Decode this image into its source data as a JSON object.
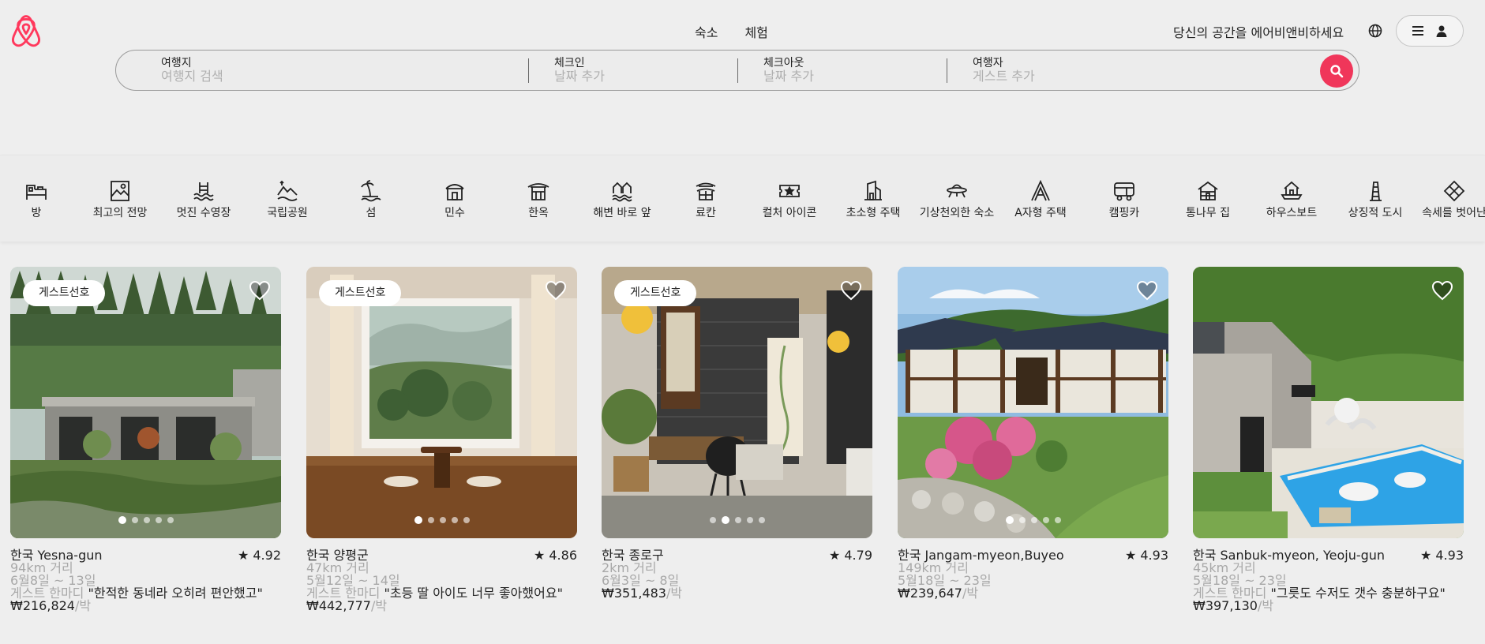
{
  "colors": {
    "brand": "#ff385c",
    "search_button": "#f0365a"
  },
  "header": {
    "tabs": [
      "숙소",
      "체험"
    ],
    "host_link": "당신의 공간을 에어비앤비하세요",
    "icons": [
      "airbnb-logo-icon",
      "globe-icon",
      "menu-icon",
      "user-icon"
    ]
  },
  "search": {
    "fields": [
      {
        "label": "여행지",
        "placeholder": "여행지 검색"
      },
      {
        "label": "체크인",
        "placeholder": "날짜 추가"
      },
      {
        "label": "체크아웃",
        "placeholder": "날짜 추가"
      },
      {
        "label": "여행자",
        "placeholder": "게스트 추가"
      }
    ],
    "button_icon": "search-icon"
  },
  "categories": [
    {
      "label": "방",
      "icon": "room-icon"
    },
    {
      "label": "최고의 전망",
      "icon": "view-icon"
    },
    {
      "label": "멋진 수영장",
      "icon": "pool-icon"
    },
    {
      "label": "국립공원",
      "icon": "national-park-icon"
    },
    {
      "label": "섬",
      "icon": "island-icon"
    },
    {
      "label": "민수",
      "icon": "minsu-icon"
    },
    {
      "label": "한옥",
      "icon": "hanok-icon"
    },
    {
      "label": "해변 바로 앞",
      "icon": "beachfront-icon"
    },
    {
      "label": "료칸",
      "icon": "ryokan-icon"
    },
    {
      "label": "컬처 아이콘",
      "icon": "ticket-icon"
    },
    {
      "label": "초소형 주택",
      "icon": "tiny-home-icon"
    },
    {
      "label": "기상천외한 숙소",
      "icon": "ufo-icon"
    },
    {
      "label": "A자형 주택",
      "icon": "a-frame-icon"
    },
    {
      "label": "캠핑카",
      "icon": "camper-icon"
    },
    {
      "label": "통나무 집",
      "icon": "cabin-icon"
    },
    {
      "label": "하우스보트",
      "icon": "houseboat-icon"
    },
    {
      "label": "상징적 도시",
      "icon": "tower-icon"
    },
    {
      "label": "속세를 벗어난",
      "icon": "off-grid-icon"
    }
  ],
  "listings": [
    {
      "badge": "게스트선호",
      "location": "한국 Yesna-gun",
      "rating": "★ 4.92",
      "distance": "94km 거리",
      "dates": "6월8일 ~ 13일",
      "review_prefix": "게스트 한마디",
      "review": "\"한적한 동네라 오히려 편안했고\"",
      "price": "₩216,824",
      "per_night": "/박",
      "dot_count": 5,
      "active_dot": 0,
      "scene": "concrete-house"
    },
    {
      "badge": "게스트선호",
      "location": "한국 양평군",
      "rating": "★ 4.86",
      "distance": "47km 거리",
      "dates": "5월12일 ~ 14일",
      "review_prefix": "게스트 한마디",
      "review": "\"초등 딸 아이도 너무 좋아했어요\"",
      "price": "₩442,777",
      "per_night": "/박",
      "dot_count": 5,
      "active_dot": 0,
      "scene": "window-room"
    },
    {
      "badge": "게스트선호",
      "location": "한국 종로구",
      "rating": "★ 4.79",
      "distance": "2km 거리",
      "dates": "6월3일 ~ 8일",
      "price": "₩351,483",
      "per_night": "/박",
      "dot_count": 5,
      "active_dot": 1,
      "scene": "courtyard"
    },
    {
      "badge": "",
      "location": "한국 Jangam-myeon,Buyeo",
      "rating": "★ 4.93",
      "distance": "149km 거리",
      "dates": "5월18일 ~ 23일",
      "price": "₩239,647",
      "per_night": "/박",
      "dot_count": 5,
      "active_dot": 0,
      "scene": "hanok"
    },
    {
      "badge": "",
      "location": "한국 Sanbuk-myeon, Yeoju-gun",
      "rating": "★ 4.93",
      "distance": "45km 거리",
      "dates": "5월18일 ~ 23일",
      "review_prefix": "게스트 한마디",
      "review": "\"그릇도 수저도 갯수 충분하구요\"",
      "price": "₩397,130",
      "per_night": "/박",
      "dot_count": 5,
      "active_dot": 0,
      "scene": "pool-house"
    }
  ]
}
